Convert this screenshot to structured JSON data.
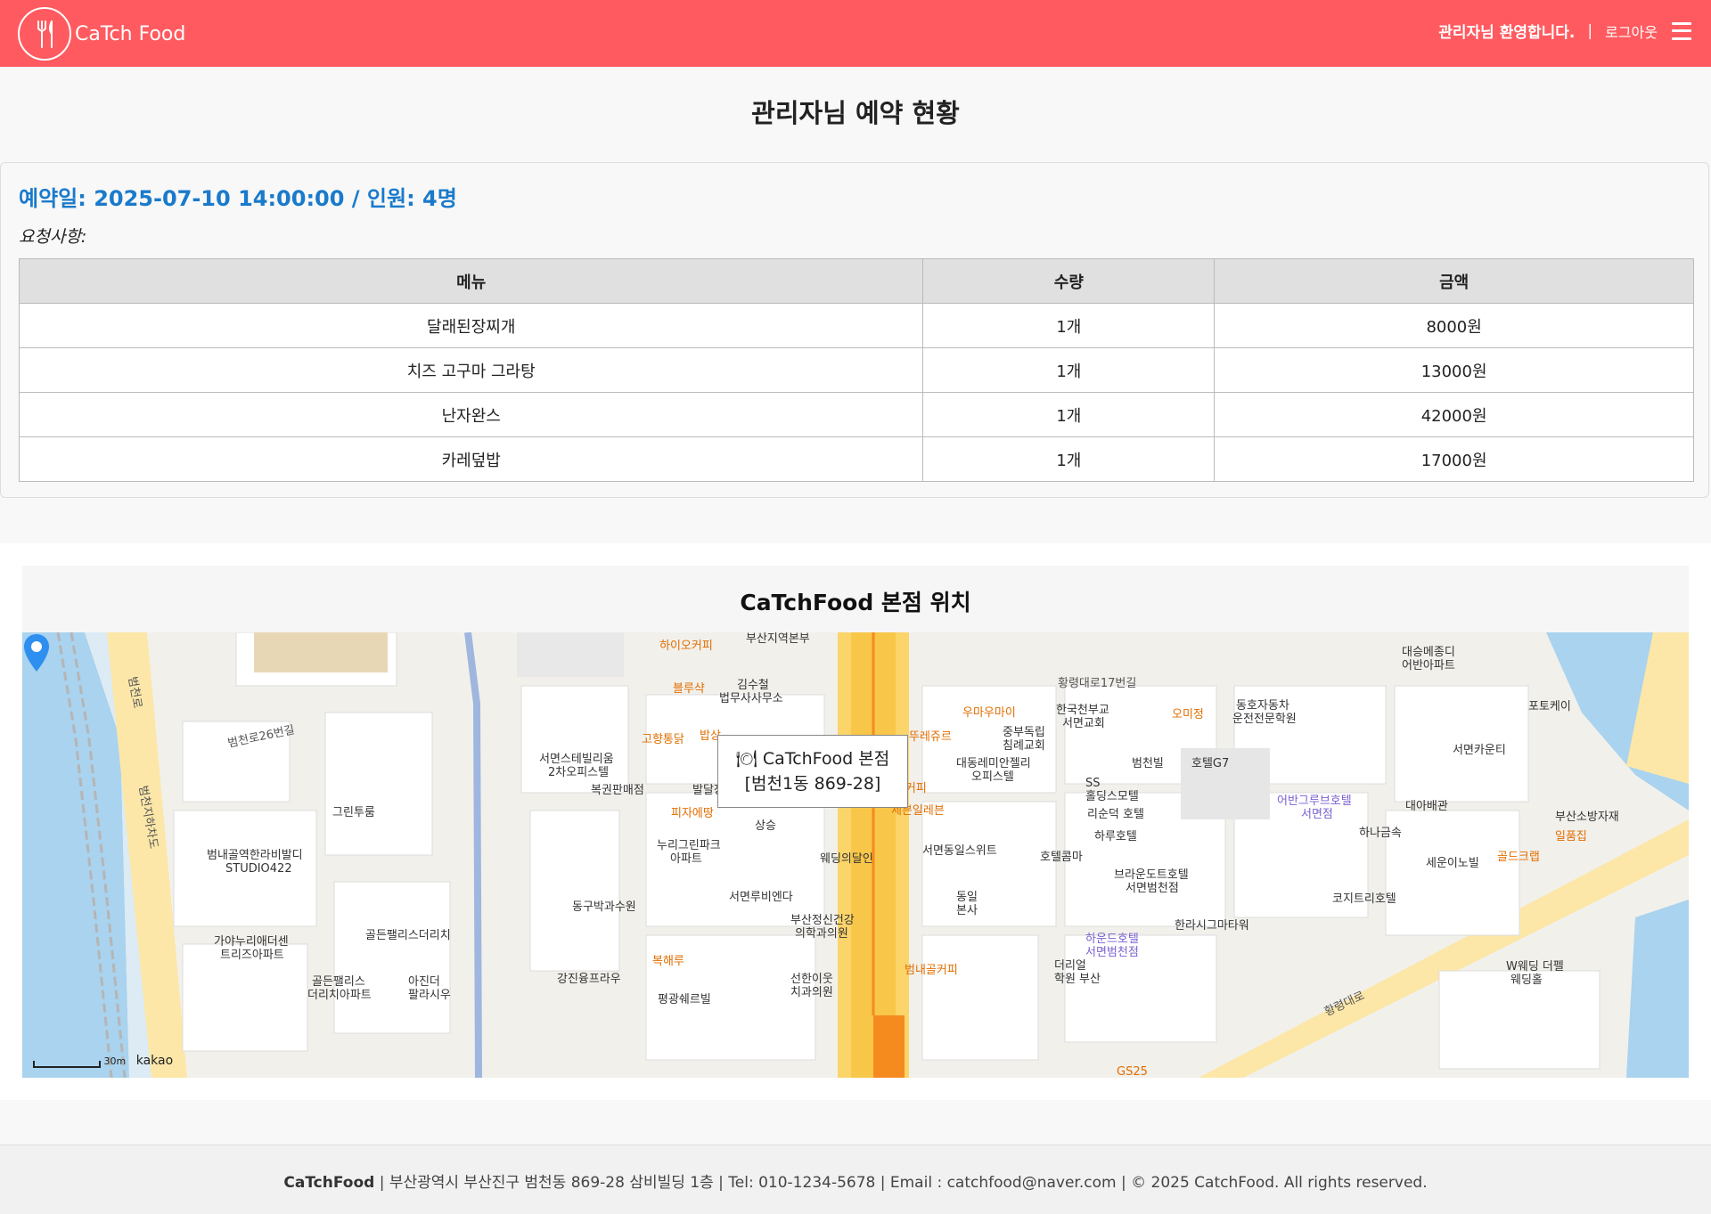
{
  "header": {
    "logo_text": "CaTch Food",
    "welcome": "관리자님 환영합니다.",
    "separator": "|",
    "logout": "로그아웃"
  },
  "page_title": "관리자님 예약 현황",
  "reservation": {
    "date_line": "예약일: 2025-07-10 14:00:00 / 인원: 4명",
    "request_label": "요청사항:",
    "columns": [
      "메뉴",
      "수량",
      "금액"
    ],
    "items": [
      {
        "menu": "달래된장찌개",
        "qty": "1개",
        "price": "8000원"
      },
      {
        "menu": "치즈 고구마 그라탕",
        "qty": "1개",
        "price": "13000원"
      },
      {
        "menu": "난자완스",
        "qty": "1개",
        "price": "42000원"
      },
      {
        "menu": "카레덮밥",
        "qty": "1개",
        "price": "17000원"
      }
    ]
  },
  "map": {
    "title": "CaTchFood 본점 위치",
    "info_line1": "🍽 CaTchFood 본점",
    "info_line2": "[범천1동 869-28]",
    "scale_label": "30m",
    "provider": "kakao",
    "labels": [
      "하이오커피",
      "부산지역본부",
      "블루샥",
      "김수철",
      "법무사사무소",
      "고향통닭",
      "밥상",
      "서면스테빌리움",
      "2차오피스텔",
      "복권판매점",
      "발달장애인지원센터",
      "피자에땅",
      "상승",
      "누리그린파크",
      "아파트",
      "웨딩의달인",
      "서면루비엔다",
      "부산정신건강",
      "의학과의원",
      "동구박과수원",
      "강진융프라우",
      "복해루",
      "평광쉐르빌",
      "선한이웃",
      "치과의원",
      "범내골커피",
      "우마우마이",
      "뚜레쥬르",
      "한국천부교",
      "서면교회",
      "중부독립",
      "침례교회",
      "대동레미안젤리",
      "오피스텔",
      "해리스커피",
      "세븐일레븐",
      "서면동일스위트",
      "동일",
      "본사",
      "SS",
      "홀딩스모텔",
      "리순덕 호텔",
      "하루호텔",
      "호텔콤마",
      "오미정",
      "동호자동차",
      "운전전문학원",
      "범천빌",
      "호텔G7",
      "어반그루브호텔",
      "서면점",
      "대아배관",
      "하나금속",
      "브라운도트호텔",
      "서면범천점",
      "한라시그마타워",
      "하운드호텔",
      "서면범천점",
      "더리얼",
      "학원 부산",
      "코지트리호텔",
      "대승메종디",
      "어반아파트",
      "포토케이",
      "서면카운티",
      "부산소방자재",
      "일품집",
      "세운이노빌",
      "골드크랩",
      "W웨딩 더펠",
      "웨딩홀",
      "그린투룸",
      "범내골역한라비발디",
      "STUDIO422",
      "가야누리애더센",
      "트리즈아파트",
      "골든팰리스더리치",
      "골든팰리스",
      "더리치아파트",
      "아진더",
      "팔라시우",
      "범천로",
      "범천지하차도",
      "범천로26번길",
      "황령대로17번길",
      "황령대로",
      "GS25"
    ]
  },
  "footer": {
    "brand": "CaTchFood",
    "info": " | 부산광역시 부산진구 범천동 869-28 삼비빌딩 1층 | Tel: 010-1234-5678 | Email : catchfood@naver.com | © 2025 CatchFood. All rights reserved."
  },
  "colors": {
    "header_bg": "#ff5a5f",
    "accent_blue": "#1a7acb"
  }
}
